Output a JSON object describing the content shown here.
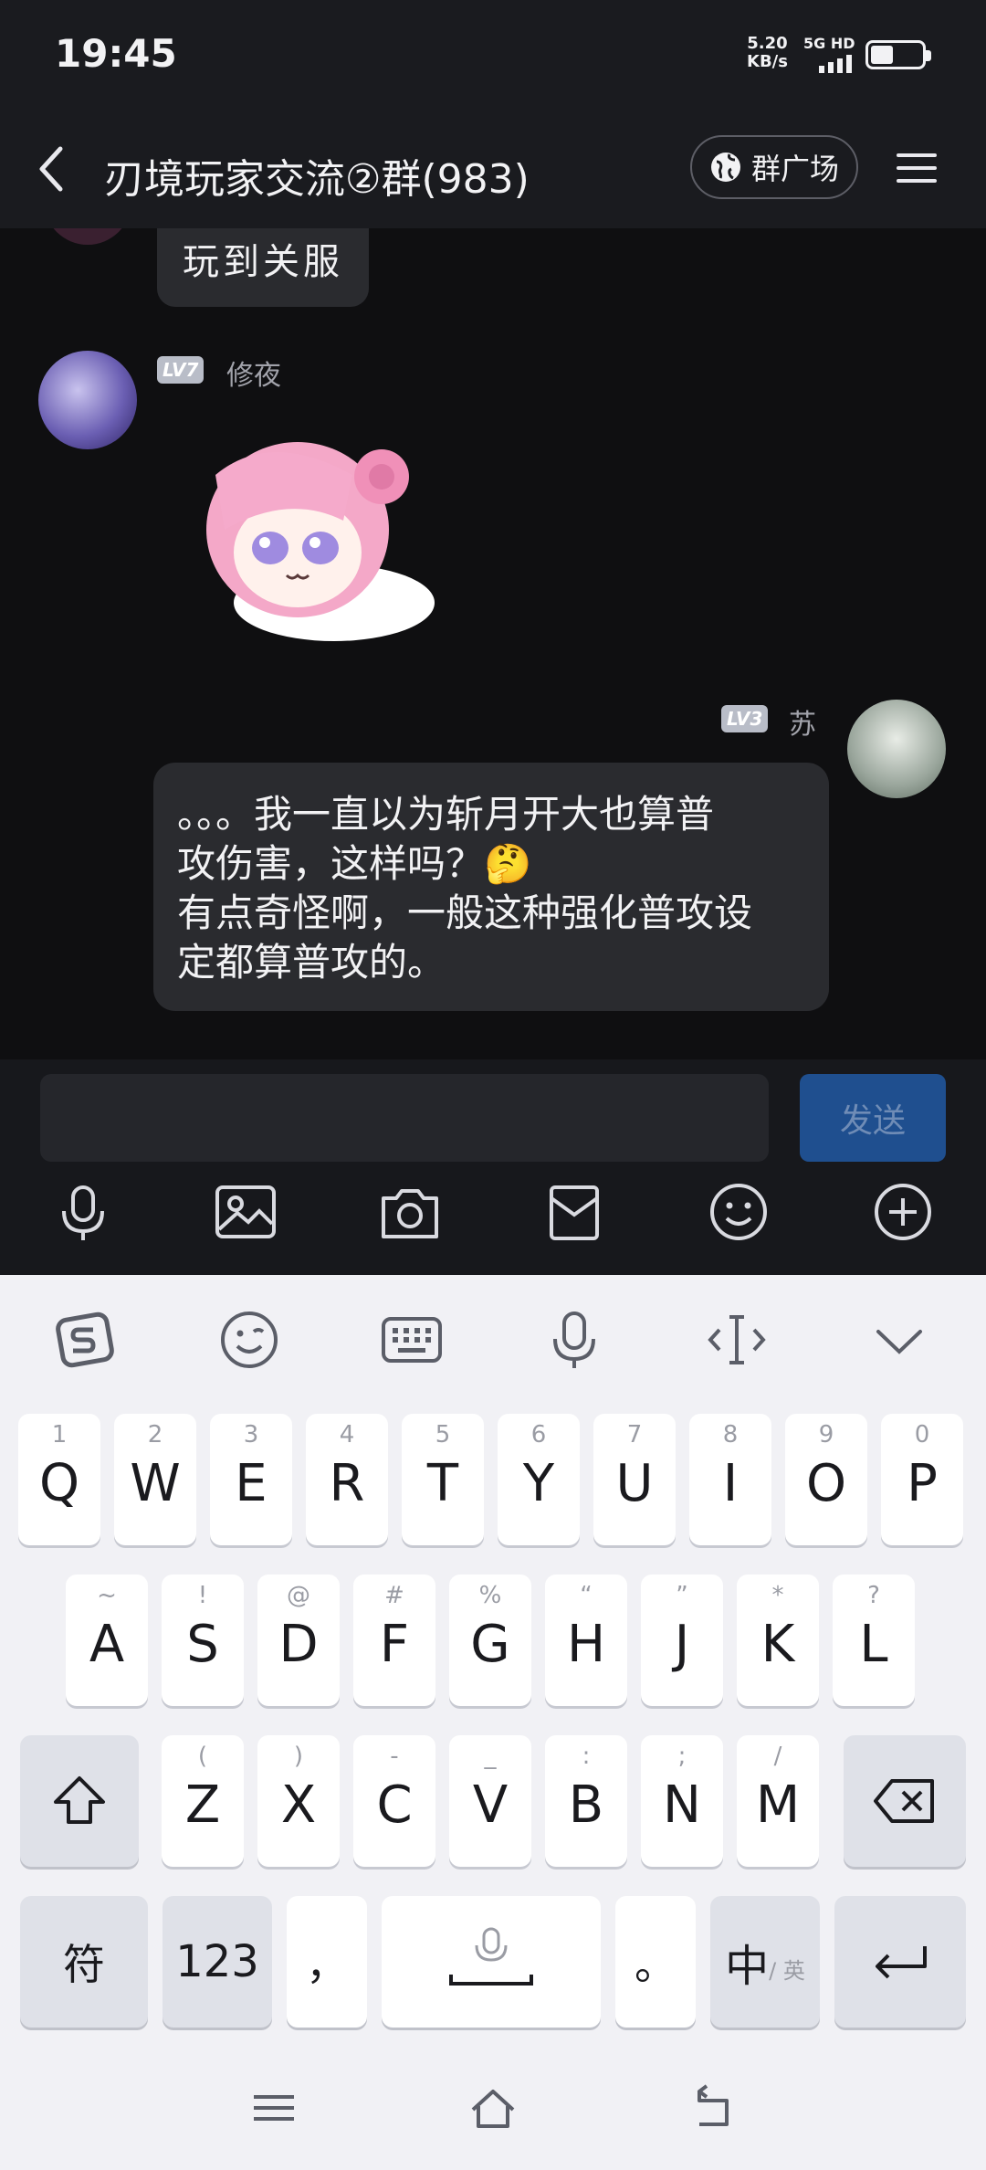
{
  "status": {
    "time": "19:45",
    "speed_value": "5.20",
    "speed_unit": "KB/s",
    "network": "5G HD",
    "battery_level": 0.45
  },
  "header": {
    "title": "刃境玩家交流②群(983)",
    "plaza_label": "群广场"
  },
  "messages": [
    {
      "text": "玩到关服"
    },
    {
      "level": "LV7",
      "sender": "修夜",
      "type": "sticker"
    },
    {
      "level": "LV3",
      "sender": "苏",
      "lines": [
        "。。。我一直以为斩月开大也算普",
        "攻伤害，这样吗？🤔",
        "有点奇怪啊，一般这种强化普攻设",
        "定都算普攻的。"
      ]
    }
  ],
  "input": {
    "value": "",
    "send_label": "发送"
  },
  "toolbar_icons": [
    "microphone-icon",
    "image-icon",
    "camera-icon",
    "envelope-icon",
    "emoji-icon",
    "plus-icon"
  ],
  "keyboard": {
    "row1": [
      {
        "k": "Q",
        "s": "1"
      },
      {
        "k": "W",
        "s": "2"
      },
      {
        "k": "E",
        "s": "3"
      },
      {
        "k": "R",
        "s": "4"
      },
      {
        "k": "T",
        "s": "5"
      },
      {
        "k": "Y",
        "s": "6"
      },
      {
        "k": "U",
        "s": "7"
      },
      {
        "k": "I",
        "s": "8"
      },
      {
        "k": "O",
        "s": "9"
      },
      {
        "k": "P",
        "s": "0"
      }
    ],
    "row2": [
      {
        "k": "A",
        "s": "~"
      },
      {
        "k": "S",
        "s": "!"
      },
      {
        "k": "D",
        "s": "@"
      },
      {
        "k": "F",
        "s": "#"
      },
      {
        "k": "G",
        "s": "%"
      },
      {
        "k": "H",
        "s": "“"
      },
      {
        "k": "J",
        "s": "”"
      },
      {
        "k": "K",
        "s": "*"
      },
      {
        "k": "L",
        "s": "?"
      }
    ],
    "row3": [
      {
        "k": "Z",
        "s": "("
      },
      {
        "k": "X",
        "s": ")"
      },
      {
        "k": "C",
        "s": "-"
      },
      {
        "k": "V",
        "s": "_"
      },
      {
        "k": "B",
        "s": ":"
      },
      {
        "k": "N",
        "s": ";"
      },
      {
        "k": "M",
        "s": "/"
      }
    ],
    "symbols_label": "符",
    "numbers_label": "123",
    "comma": "，",
    "period": "。",
    "lang_main": "中",
    "lang_sub": "/ 英"
  }
}
